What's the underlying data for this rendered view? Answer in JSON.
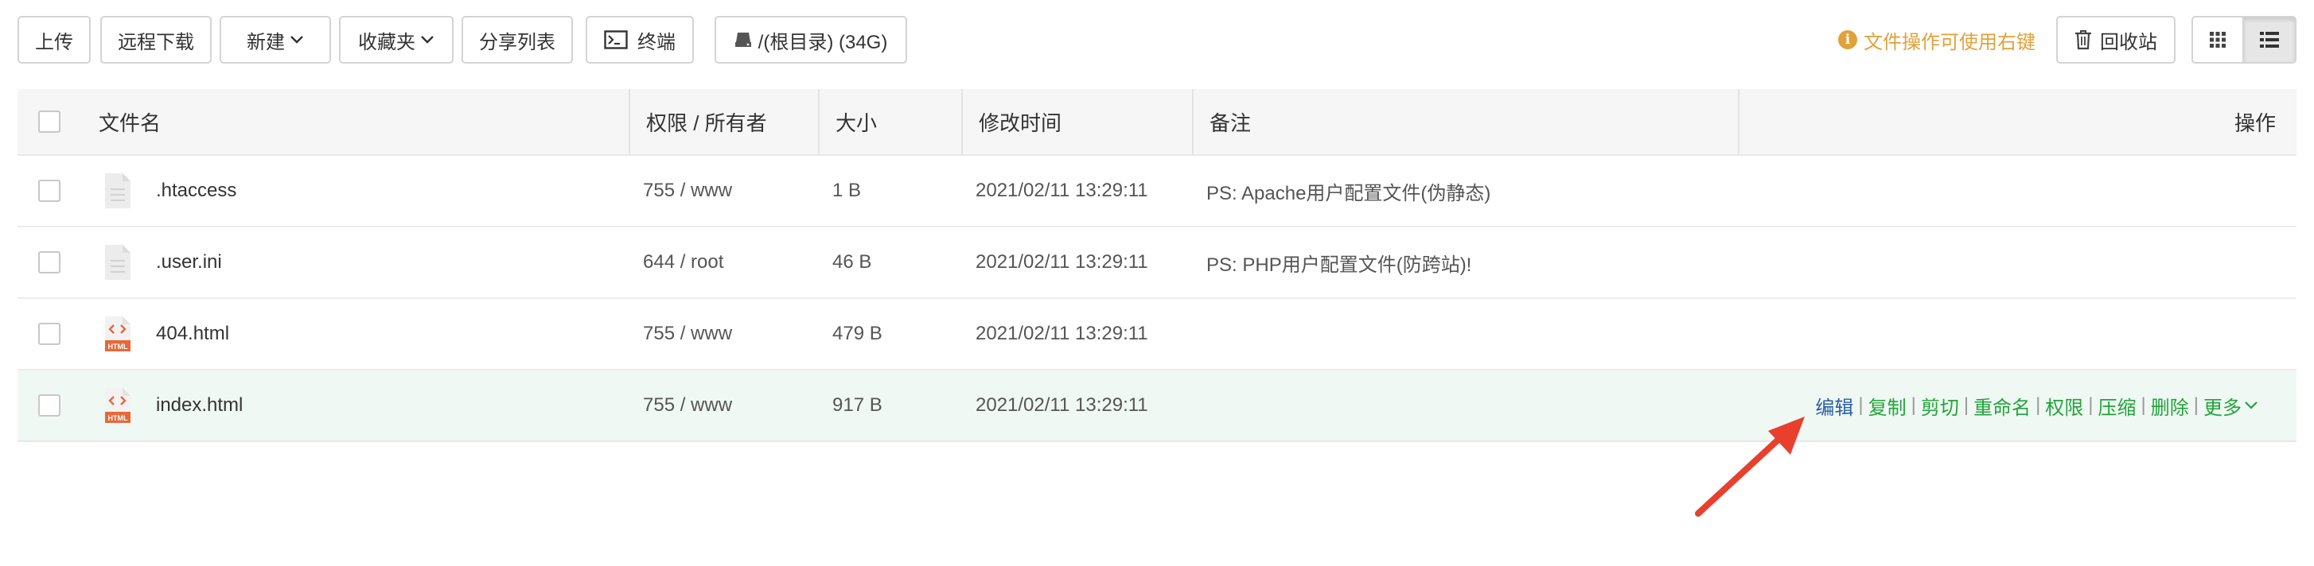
{
  "toolbar": {
    "upload": "上传",
    "remote_download": "远程下载",
    "new": "新建",
    "favorites": "收藏夹",
    "share_list": "分享列表",
    "terminal": "终端",
    "path": "/(根目录) (34G)",
    "hint": "文件操作可使用右键",
    "recycle": "回收站"
  },
  "table": {
    "headers": {
      "name": "文件名",
      "perm": "权限 / 所有者",
      "size": "大小",
      "mtime": "修改时间",
      "note": "备注",
      "ops": "操作"
    },
    "rows": [
      {
        "name": ".htaccess",
        "icon": "text-file-icon",
        "perm": "755 / www",
        "size": "1 B",
        "mtime": "2021/02/11 13:29:11",
        "note": "PS: Apache用户配置文件(伪静态)"
      },
      {
        "name": ".user.ini",
        "icon": "text-file-icon",
        "perm": "644 / root",
        "size": "46 B",
        "mtime": "2021/02/11 13:29:11",
        "note": "PS: PHP用户配置文件(防跨站)!"
      },
      {
        "name": "404.html",
        "icon": "html-file-icon",
        "perm": "755 / www",
        "size": "479 B",
        "mtime": "2021/02/11 13:29:11",
        "note": ""
      },
      {
        "name": "index.html",
        "icon": "html-file-icon",
        "perm": "755 / www",
        "size": "917 B",
        "mtime": "2021/02/11 13:29:11",
        "note": ""
      }
    ],
    "row_actions": {
      "edit": "编辑",
      "copy": "复制",
      "cut": "剪切",
      "rename": "重命名",
      "perm": "权限",
      "compress": "压缩",
      "delete": "删除",
      "more": "更多",
      "separator": "|"
    }
  },
  "html_icon_label": "HTML",
  "colors": {
    "accent_green": "#20a53a",
    "hint_orange": "#e0a23b",
    "edit_blue": "#2a5fa6",
    "arrow_red": "#e8402d",
    "html_icon": "#e8683a"
  }
}
